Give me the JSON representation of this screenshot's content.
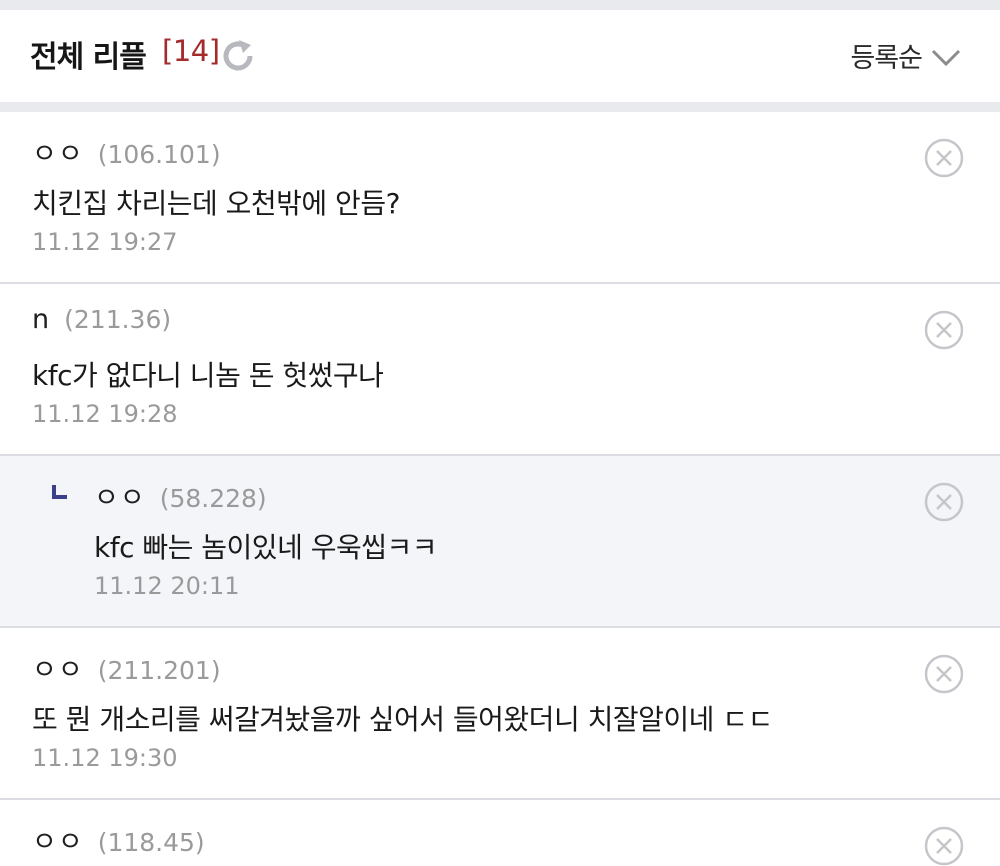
{
  "header": {
    "title": "전체 리플",
    "count": "[14]",
    "refresh_icon": "refresh-icon",
    "sort_label": "등록순",
    "sort_icon": "chevron-down-icon"
  },
  "colors": {
    "count": "#a32b2b",
    "reply_bg": "#f4f5f9",
    "reply_marker": "#3b3f8c",
    "muted_text": "#9a9a9a",
    "separator": "#e9eaee"
  },
  "comments": [
    {
      "author": "ㅇㅇ",
      "ip": "(106.101)",
      "body": "치킨집 차리는데 오천밖에 안듬?",
      "time": "11.12 19:27",
      "is_reply": false
    },
    {
      "author": "n",
      "ip": "(211.36)",
      "body": "kfc가 없다니 니놈 돈 헛썼구나",
      "time": "11.12 19:28",
      "is_reply": false
    },
    {
      "author": "ㅇㅇ",
      "ip": "(58.228)",
      "body": "kfc 빠는 놈이있네 우욱씹ㅋㅋ",
      "time": "11.12 20:11",
      "is_reply": true
    },
    {
      "author": "ㅇㅇ",
      "ip": "(211.201)",
      "body": "또 뭔 개소리를 써갈겨놨을까 싶어서 들어왔더니 치잘알이네 ㄷㄷ",
      "time": "11.12 19:30",
      "is_reply": false
    },
    {
      "author": "ㅇㅇ",
      "ip": "(118.45)",
      "body": "",
      "time": "",
      "is_reply": false
    }
  ]
}
